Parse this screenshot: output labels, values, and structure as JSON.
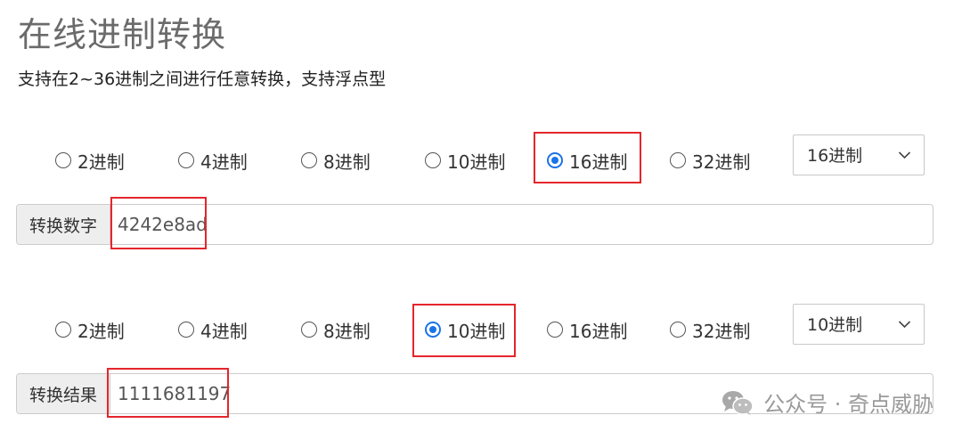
{
  "page": {
    "title": "在线进制转换",
    "subtitle": "支持在2~36进制之间进行任意转换，支持浮点型"
  },
  "input_section": {
    "radios": [
      {
        "label": "2进制",
        "checked": false
      },
      {
        "label": "4进制",
        "checked": false
      },
      {
        "label": "8进制",
        "checked": false
      },
      {
        "label": "10进制",
        "checked": false
      },
      {
        "label": "16进制",
        "checked": true
      },
      {
        "label": "32进制",
        "checked": false
      }
    ],
    "select_value": "16进制",
    "field_label": "转换数字",
    "field_value": "4242e8ad"
  },
  "output_section": {
    "radios": [
      {
        "label": "2进制",
        "checked": false
      },
      {
        "label": "4进制",
        "checked": false
      },
      {
        "label": "8进制",
        "checked": false
      },
      {
        "label": "10进制",
        "checked": true
      },
      {
        "label": "16进制",
        "checked": false
      },
      {
        "label": "32进制",
        "checked": false
      }
    ],
    "select_value": "10进制",
    "field_label": "转换结果",
    "field_value": "1111681197"
  },
  "watermark": {
    "text": "公众号 · 奇点威胁",
    "icon": "wechat-icon"
  },
  "colors": {
    "highlight_border": "#e4262c",
    "radio_checked": "#1a73e8",
    "addon_bg": "#eeeeee"
  }
}
